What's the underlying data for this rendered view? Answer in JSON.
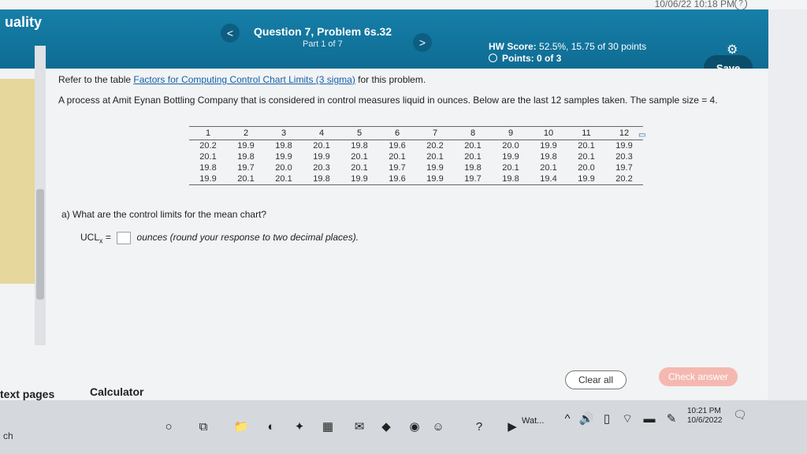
{
  "system": {
    "clock": "10/06/22 10:18 PM",
    "help_icon": "help-icon"
  },
  "header": {
    "brand": "uality",
    "question_title": "Question 7, Problem 6s.32",
    "question_part": "Part 1 of 7",
    "prev_label": "<",
    "next_label": ">",
    "hw_score_label": "HW Score:",
    "hw_score_value": "52.5%, 15.75 of 30 points",
    "points_label": "Points: 0 of 3",
    "save_label": "Save"
  },
  "content": {
    "back_label": "⇤",
    "intro_prefix": "Refer to the table ",
    "intro_link": "Factors for Computing Control Chart Limits (3 sigma)",
    "intro_suffix": " for this problem.",
    "problem_text": "A process at Amit Eynan Bottling Company that is considered in control measures liquid in ounces. Below are the last 12 samples taken. The sample size = 4.",
    "table": {
      "headers": [
        "1",
        "2",
        "3",
        "4",
        "5",
        "6",
        "7",
        "8",
        "9",
        "10",
        "11",
        "12"
      ],
      "rows": [
        [
          "20.2",
          "19.9",
          "19.8",
          "20.1",
          "19.8",
          "19.6",
          "20.2",
          "20.1",
          "20.0",
          "19.9",
          "20.1",
          "19.9"
        ],
        [
          "20.1",
          "19.8",
          "19.9",
          "19.9",
          "20.1",
          "20.1",
          "20.1",
          "20.1",
          "19.9",
          "19.8",
          "20.1",
          "20.3"
        ],
        [
          "19.8",
          "19.7",
          "20.0",
          "20.3",
          "20.1",
          "19.7",
          "19.9",
          "19.8",
          "20.1",
          "20.1",
          "20.0",
          "19.7"
        ],
        [
          "19.9",
          "20.1",
          "20.1",
          "19.8",
          "19.9",
          "19.6",
          "19.9",
          "19.7",
          "19.8",
          "19.4",
          "19.9",
          "20.2"
        ]
      ]
    },
    "part_a": "a) What are the control limits for the mean chart?",
    "ucl_label": "UCL",
    "ucl_sub": "x",
    "ucl_eq": " =",
    "ucl_suffix": "ounces (round your response to two decimal places)."
  },
  "bottom": {
    "text_pages": "text pages",
    "calculator": "Calculator",
    "clear_all": "Clear all",
    "check_answer": "Check answer"
  },
  "taskbar": {
    "search_fragment": "ch",
    "app_label": "Wat...",
    "time": "10:21 PM",
    "date": "10/6/2022"
  }
}
